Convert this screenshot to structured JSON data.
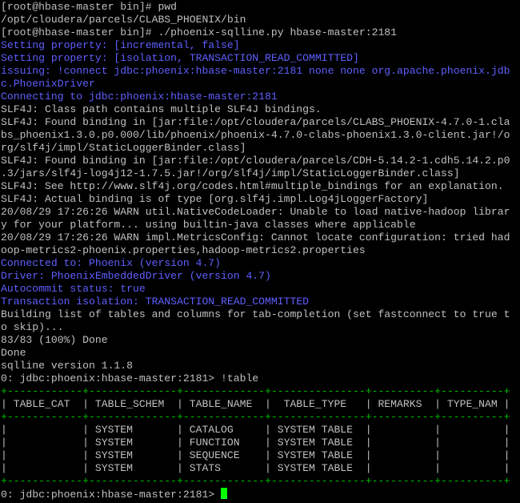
{
  "terminal": {
    "colors": {
      "background": "#000000",
      "text": "#c0c0c0",
      "info": "#5f5fff",
      "table_border": "#00c000",
      "cursor": "#00ff00"
    },
    "lines": [
      {
        "text": "[root@hbase-master bin]# pwd",
        "color": "white"
      },
      {
        "text": "/opt/cloudera/parcels/CLABS_PHOENIX/bin",
        "color": "white"
      },
      {
        "text": "[root@hbase-master bin]# ./phoenix-sqlline.py hbase-master:2181",
        "color": "white"
      },
      {
        "text": "Setting property: [incremental, false]",
        "color": "blue"
      },
      {
        "text": "Setting property: [isolation, TRANSACTION_READ_COMMITTED]",
        "color": "blue"
      },
      {
        "text": "issuing: !connect jdbc:phoenix:hbase-master:2181 none none org.apache.phoenix.jdb",
        "color": "blue"
      },
      {
        "text": "c.PhoenixDriver",
        "color": "blue"
      },
      {
        "text": "Connecting to jdbc:phoenix:hbase-master:2181",
        "color": "blue"
      },
      {
        "text": "SLF4J: Class path contains multiple SLF4J bindings.",
        "color": "white"
      },
      {
        "text": "SLF4J: Found binding in [jar:file:/opt/cloudera/parcels/CLABS_PHOENIX-4.7.0-1.cla",
        "color": "white"
      },
      {
        "text": "bs_phoenix1.3.0.p0.000/lib/phoenix/phoenix-4.7.0-clabs-phoenix1.3.0-client.jar!/o",
        "color": "white"
      },
      {
        "text": "rg/slf4j/impl/StaticLoggerBinder.class]",
        "color": "white"
      },
      {
        "text": "SLF4J: Found binding in [jar:file:/opt/cloudera/parcels/CDH-5.14.2-1.cdh5.14.2.p0",
        "color": "white"
      },
      {
        "text": ".3/jars/slf4j-log4j12-1.7.5.jar!/org/slf4j/impl/StaticLoggerBinder.class]",
        "color": "white"
      },
      {
        "text": "SLF4J: See http://www.slf4j.org/codes.html#multiple_bindings for an explanation.",
        "color": "white"
      },
      {
        "text": "SLF4J: Actual binding is of type [org.slf4j.impl.Log4jLoggerFactory]",
        "color": "white"
      },
      {
        "text": "20/08/29 17:26:26 WARN util.NativeCodeLoader: Unable to load native-hadoop librar",
        "color": "white"
      },
      {
        "text": "y for your platform... using builtin-java classes where applicable",
        "color": "white"
      },
      {
        "text": "20/08/29 17:26:26 WARN impl.MetricsConfig: Cannot locate configuration: tried had",
        "color": "white"
      },
      {
        "text": "oop-metrics2-phoenix.properties,hadoop-metrics2.properties",
        "color": "white"
      },
      {
        "text": "Connected to: Phoenix (version 4.7)",
        "color": "blue"
      },
      {
        "text": "Driver: PhoenixEmbeddedDriver (version 4.7)",
        "color": "blue"
      },
      {
        "text": "Autocommit status: true",
        "color": "blue"
      },
      {
        "text": "Transaction isolation: TRANSACTION_READ_COMMITTED",
        "color": "blue"
      },
      {
        "text": "Building list of tables and columns for tab-completion (set fastconnect to true t",
        "color": "white"
      },
      {
        "text": "o skip)...",
        "color": "white"
      },
      {
        "text": "83/83 (100%) Done",
        "color": "white"
      },
      {
        "text": "Done",
        "color": "white"
      },
      {
        "text": "sqlline version 1.1.8",
        "color": "white"
      },
      {
        "text": "0: jdbc:phoenix:hbase-master:2181> !table",
        "color": "white"
      },
      {
        "text": "+------------+--------------+-------------+---------------+----------+----------+",
        "color": "green"
      },
      {
        "text": "| TABLE_CAT  | TABLE_SCHEM  | TABLE_NAME  |  TABLE_TYPE   | REMARKS  | TYPE_NAM |",
        "color": "white"
      },
      {
        "text": "+------------+--------------+-------------+---------------+----------+----------+",
        "color": "green"
      },
      {
        "text": "|            | SYSTEM       | CATALOG     | SYSTEM TABLE  |          |          |",
        "color": "white"
      },
      {
        "text": "|            | SYSTEM       | FUNCTION    | SYSTEM TABLE  |          |          |",
        "color": "white"
      },
      {
        "text": "|            | SYSTEM       | SEQUENCE    | SYSTEM TABLE  |          |          |",
        "color": "white"
      },
      {
        "text": "|            | SYSTEM       | STATS       | SYSTEM TABLE  |          |          |",
        "color": "white"
      },
      {
        "text": "+------------+--------------+-------------+---------------+----------+----------+",
        "color": "green"
      }
    ],
    "prompt": "0: jdbc:phoenix:hbase-master:2181> "
  }
}
